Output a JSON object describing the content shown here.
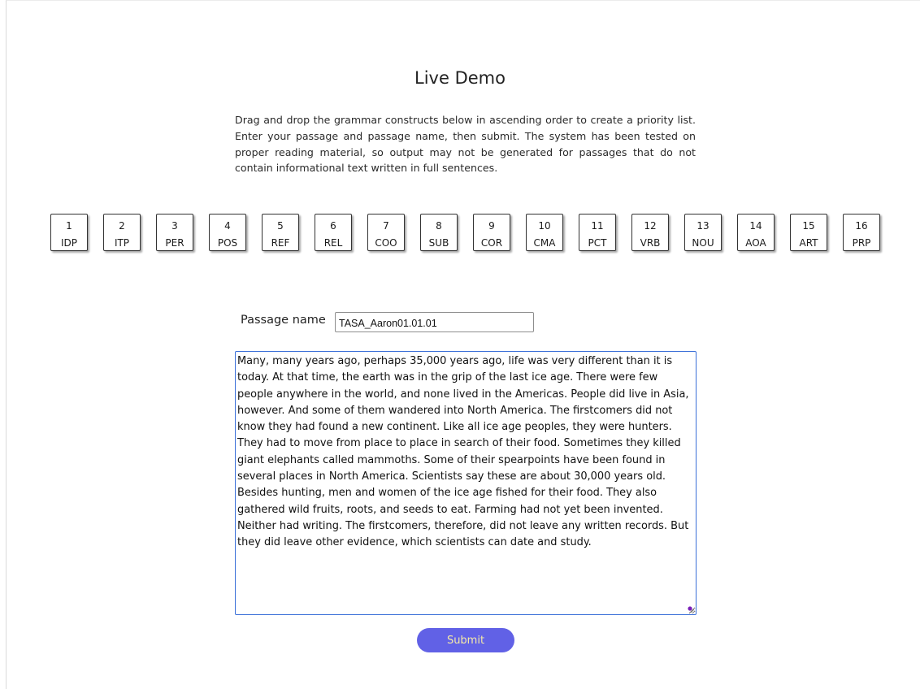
{
  "page": {
    "title": "Live Demo",
    "intro": "Drag and drop the grammar constructs below in ascending order to create a priority list. Enter your passage and passage name, then submit. The system has been tested on proper reading material, so output may not be generated for passages that do not contain informational text written in full sentences."
  },
  "constructs": [
    {
      "num": "1",
      "abbr": "IDP"
    },
    {
      "num": "2",
      "abbr": "ITP"
    },
    {
      "num": "3",
      "abbr": "PER"
    },
    {
      "num": "4",
      "abbr": "POS"
    },
    {
      "num": "5",
      "abbr": "REF"
    },
    {
      "num": "6",
      "abbr": "REL"
    },
    {
      "num": "7",
      "abbr": "COO"
    },
    {
      "num": "8",
      "abbr": "SUB"
    },
    {
      "num": "9",
      "abbr": "COR"
    },
    {
      "num": "10",
      "abbr": "CMA"
    },
    {
      "num": "11",
      "abbr": "PCT"
    },
    {
      "num": "12",
      "abbr": "VRB"
    },
    {
      "num": "13",
      "abbr": "NOU"
    },
    {
      "num": "14",
      "abbr": "AOA"
    },
    {
      "num": "15",
      "abbr": "ART"
    },
    {
      "num": "16",
      "abbr": "PRP"
    }
  ],
  "form": {
    "passage_name_label": "Passage name",
    "passage_name_value": "TASA_Aaron01.01.01",
    "passage_text": "Many, many years ago, perhaps 35,000 years ago, life was very different than it is today. At that time, the earth was in the grip of the last ice age. There were few people anywhere in the world, and none lived in the Americas. People did live in Asia, however. And some of them wandered into North America. The firstcomers did not know they had found a new continent. Like all ice age peoples, they were hunters. They had to move from place to place in search of their food. Sometimes they killed giant elephants called mammoths. Some of their spearpoints have been found in several places in North America. Scientists say these are about 30,000 years old. Besides hunting, men and women of the ice age fished for their food. They also gathered wild fruits, roots, and seeds to eat. Farming had not yet been invented. Neither had writing. The firstcomers, therefore, did not leave any written records. But they did leave other evidence, which scientists can date and study.",
    "submit_label": "Submit"
  },
  "colors": {
    "submit_bg": "#6161e6",
    "submit_text": "#f4e9a8",
    "textarea_focus_border": "#3a6fd8"
  }
}
